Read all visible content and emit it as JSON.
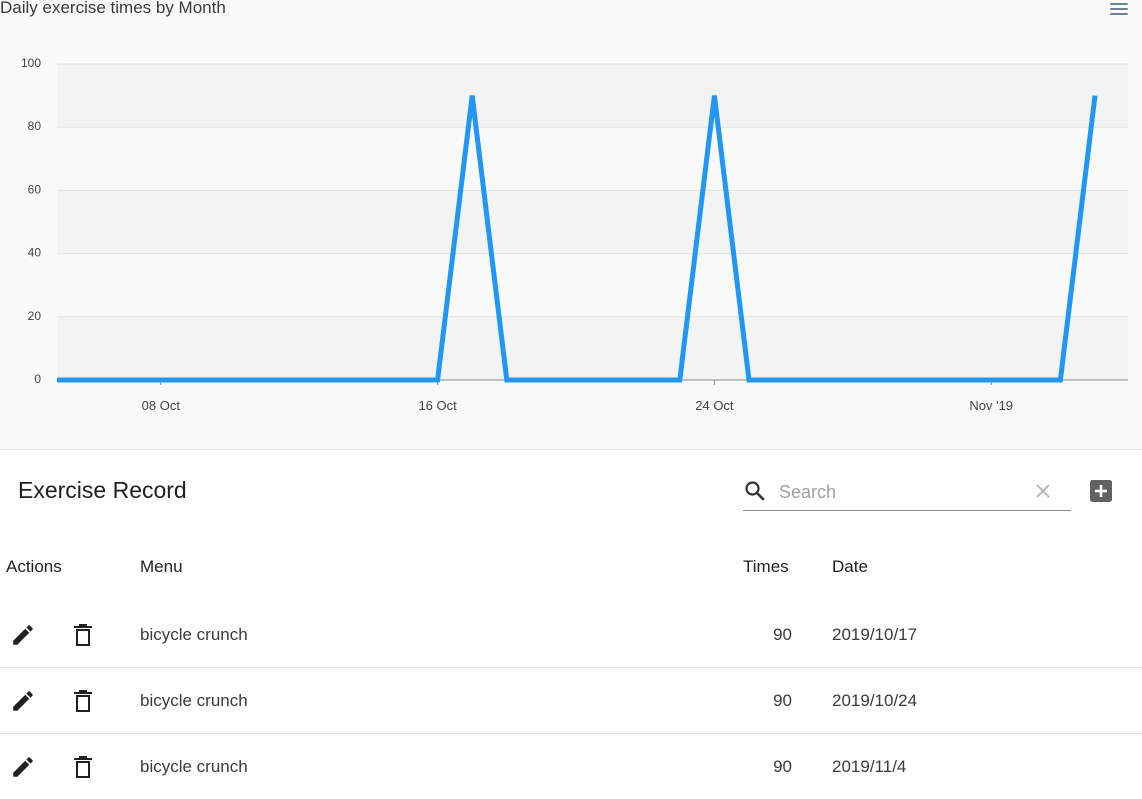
{
  "chart_title": "Daily exercise times by Month",
  "chart_data": {
    "type": "area",
    "title": "Daily exercise times by Month",
    "xlabel": "",
    "ylabel": "",
    "y_ticks": [
      "0",
      "20",
      "40",
      "60",
      "80",
      "100"
    ],
    "x_ticks": [
      "08 Oct",
      "16 Oct",
      "24 Oct",
      "Nov '19"
    ],
    "ylim": [
      0,
      100
    ],
    "xlim": [
      "2019-10-05",
      "2019-11-05"
    ],
    "grid": true,
    "series": [
      {
        "color": "#2196F3",
        "points": [
          {
            "x": "2019-10-05",
            "y": 0
          },
          {
            "x": "2019-10-16",
            "y": 0
          },
          {
            "x": "2019-10-17",
            "y": 90
          },
          {
            "x": "2019-10-18",
            "y": 0
          },
          {
            "x": "2019-10-23",
            "y": 0
          },
          {
            "x": "2019-10-24",
            "y": 90
          },
          {
            "x": "2019-10-25",
            "y": 0
          },
          {
            "x": "2019-11-03",
            "y": 0
          },
          {
            "x": "2019-11-04",
            "y": 90
          }
        ]
      }
    ]
  },
  "colors": {
    "line": "#2196F3",
    "accent_icon": "#616161"
  },
  "table": {
    "title": "Exercise Record",
    "search_placeholder": "Search",
    "search_value": "",
    "icons": {
      "search": "search-icon",
      "clear": "close-icon",
      "add": "add-box-icon",
      "menu": "hamburger-menu-icon",
      "edit": "pencil-icon",
      "delete": "trash-icon"
    },
    "columns": {
      "actions": "Actions",
      "menu": "Menu",
      "times": "Times",
      "date": "Date"
    },
    "rows": [
      {
        "menu": "bicycle crunch",
        "times": "90",
        "date": "2019/10/17"
      },
      {
        "menu": "bicycle crunch",
        "times": "90",
        "date": "2019/10/24"
      },
      {
        "menu": "bicycle crunch",
        "times": "90",
        "date": "2019/11/4"
      }
    ]
  }
}
